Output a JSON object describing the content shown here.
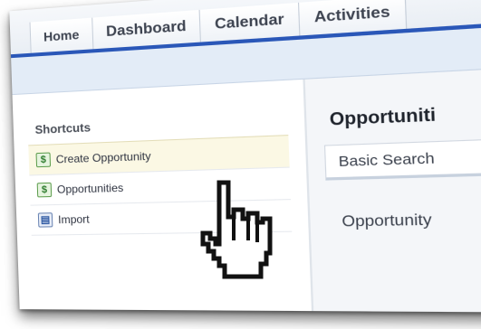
{
  "nav": {
    "tabs": [
      {
        "label": "Home"
      },
      {
        "label": "Dashboard"
      },
      {
        "label": "Calendar"
      },
      {
        "label": "Activities"
      }
    ]
  },
  "sidebar": {
    "title": "Shortcuts",
    "items": [
      {
        "label": "Create Opportunity",
        "icon": "opportunity-plus-icon"
      },
      {
        "label": "Opportunities",
        "icon": "opportunity-icon"
      },
      {
        "label": "Import",
        "icon": "import-icon"
      }
    ]
  },
  "main": {
    "title": "Opportuniti",
    "basic_search_label": "Basic Search",
    "field_label": "Opportunity"
  },
  "colors": {
    "nav_underline": "#2a57b8",
    "subbar": "#e3ecf7",
    "highlight": "#fbf8e4",
    "icon_green": "#2b7a2b"
  },
  "icons": {
    "cursor": "hand-pointer-icon"
  }
}
